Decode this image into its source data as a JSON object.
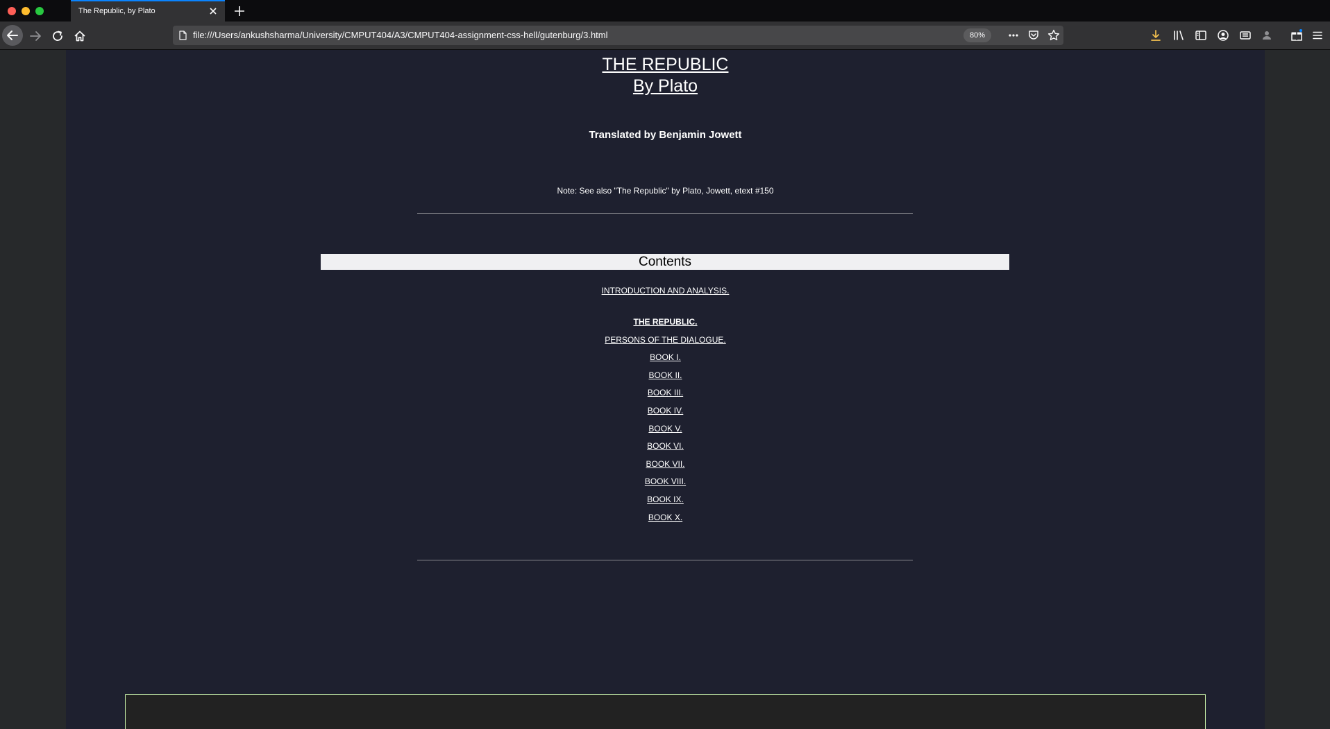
{
  "browser": {
    "tab_title": "The Republic, by Plato",
    "url": "file:///Users/ankushsharma/University/CMPUT404/A3/CMPUT404-assignment-css-hell/gutenburg/3.html",
    "zoom": "80%",
    "accent_color": "#0a84ff"
  },
  "page": {
    "title_line1": "THE REPUBLIC",
    "title_line2": "By Plato",
    "translator": "Translated by Benjamin Jowett",
    "note": "Note: See also \"The Republic\" by Plato, Jowett, etext #150",
    "contents_heading": "Contents",
    "toc": [
      "INTRODUCTION AND ANALYSIS.",
      "THE REPUBLIC.",
      "PERSONS OF THE DIALOGUE.",
      "BOOK I.",
      "BOOK II.",
      "BOOK III.",
      "BOOK IV.",
      "BOOK V.",
      "BOOK VI.",
      "BOOK VII.",
      "BOOK VIII.",
      "BOOK IX.",
      "BOOK X."
    ]
  },
  "icons": {
    "back": "back-arrow-icon",
    "forward": "forward-arrow-icon",
    "reload": "reload-icon",
    "home": "home-icon",
    "page": "page-icon",
    "more": "more-icon",
    "pocket": "pocket-icon",
    "bookmark": "bookmark-star-icon",
    "downloads": "downloads-icon",
    "library": "library-icon",
    "sidebar": "sidebar-icon",
    "account": "account-icon",
    "reader": "reader-icon",
    "extension": "extension-icon",
    "whats_new": "gift-icon",
    "menu": "hamburger-menu-icon"
  }
}
